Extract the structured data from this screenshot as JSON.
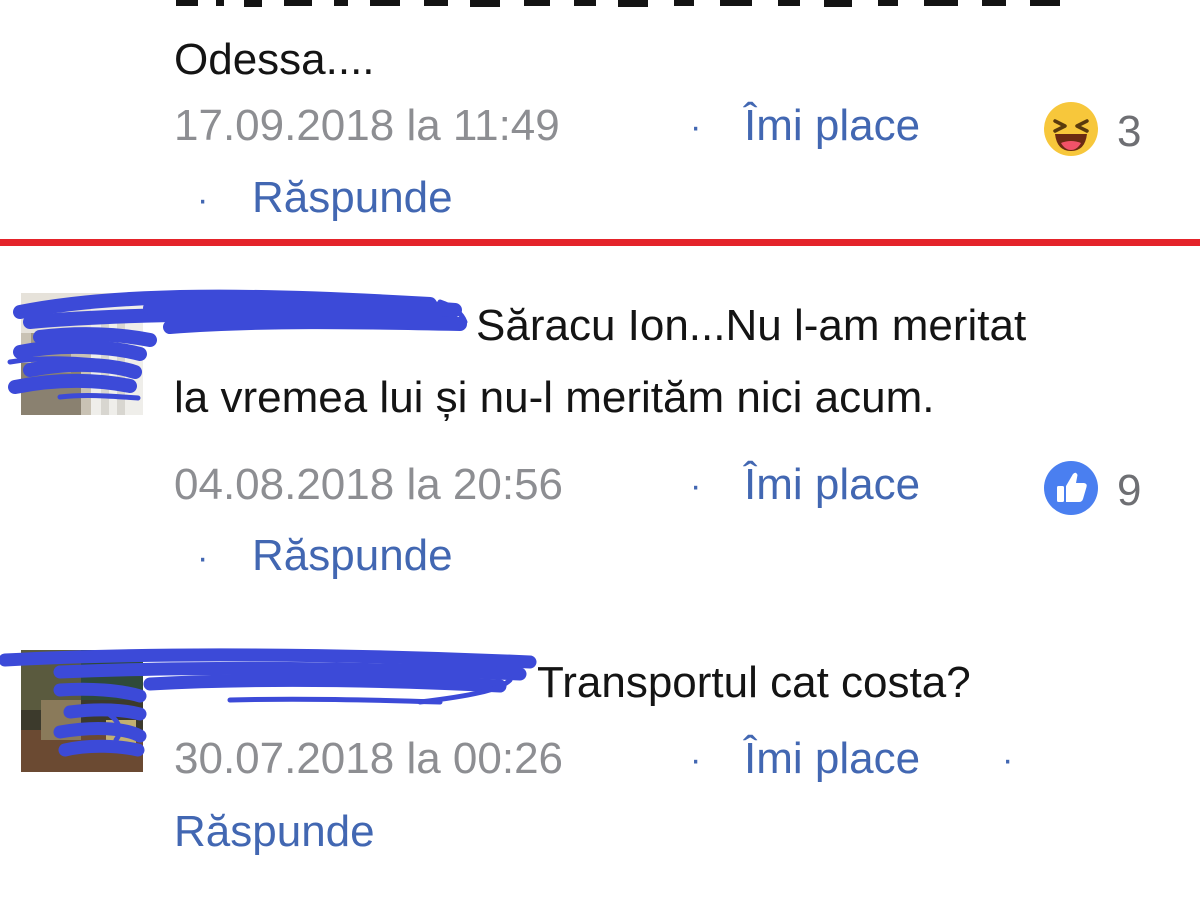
{
  "comments": [
    {
      "text_partial": "Odessa....",
      "timestamp": "17.09.2018 la 11:49",
      "separator": "·",
      "like_label": "Îmi place",
      "reaction_icon": "haha-emoji-icon",
      "reaction_count": "3",
      "reply_label": "Răspunde"
    },
    {
      "text_line1": "Săracu Ion...Nu l-am meritat",
      "text_line2": "la vremea lui și nu-l merităm nici acum.",
      "timestamp": "04.08.2018 la 20:56",
      "separator": "·",
      "like_label": "Îmi place",
      "reaction_icon": "thumbs-up-icon",
      "reaction_count": "9",
      "reply_label": "Răspunde"
    },
    {
      "text": "Transportul cat costa?",
      "timestamp": "30.07.2018 la 00:26",
      "separator": "·",
      "like_label": "Îmi place",
      "reply_label": "Răspunde"
    }
  ],
  "colors": {
    "link": "#4267b2",
    "meta": "#8d8e92",
    "divider": "#e4232a",
    "scribble": "#3c4ad8",
    "haha": "#f7c73b",
    "like": "#4a7ff0"
  }
}
